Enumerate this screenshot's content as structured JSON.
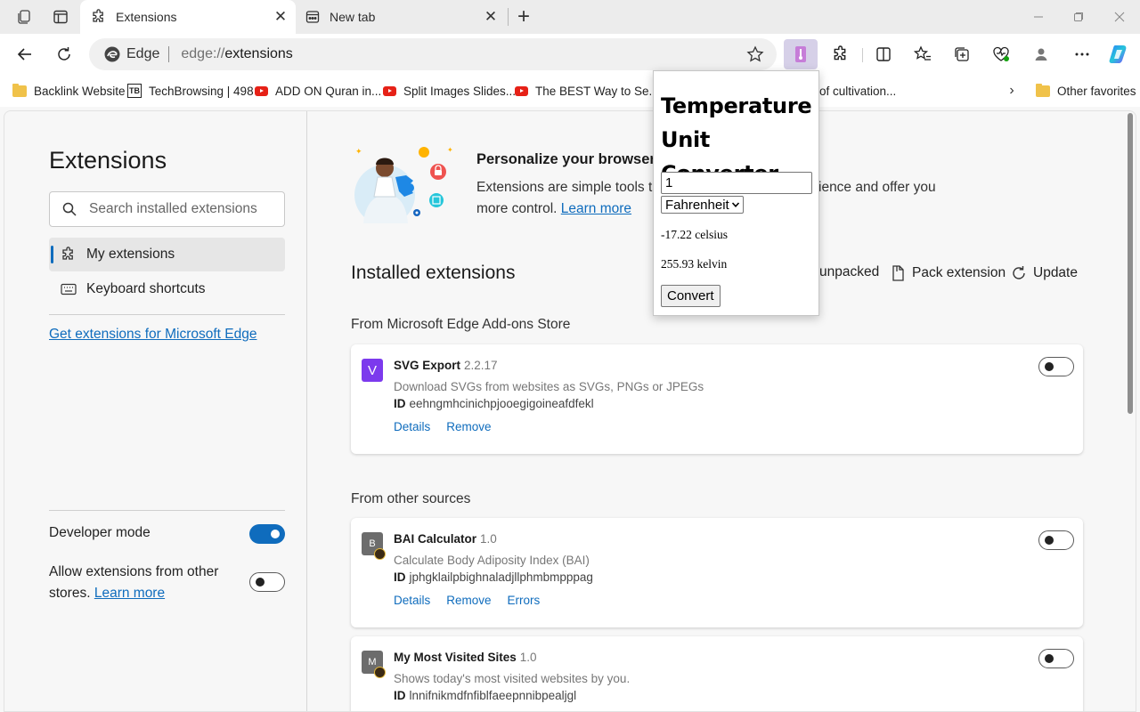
{
  "browser": {
    "tabs": [
      {
        "title": "Extensions",
        "active": true
      },
      {
        "title": "New tab",
        "active": false
      }
    ],
    "address": {
      "site_label": "Edge",
      "url_scheme": "edge://",
      "url_host": "extensions"
    },
    "favorites": [
      {
        "label": "Backlink Website",
        "icon": "folder-icon"
      },
      {
        "label": "TechBrowsing | 498",
        "icon": "techbrowsing-icon",
        "icon_text": "TB"
      },
      {
        "label": "ADD ON Quran in...",
        "icon": "youtube-icon"
      },
      {
        "label": "Split Images Slides...",
        "icon": "youtube-icon"
      },
      {
        "label": "The BEST Way to Se...",
        "icon": "youtube-icon"
      },
      {
        "label": "of cultivation...",
        "icon": "youtube-icon"
      }
    ],
    "other_favorites": "Other favorites"
  },
  "sidebar": {
    "title": "Extensions",
    "search_placeholder": "Search installed extensions",
    "nav": [
      {
        "label": "My extensions",
        "icon": "puzzle-icon",
        "selected": true
      },
      {
        "label": "Keyboard shortcuts",
        "icon": "keyboard-icon",
        "selected": false
      }
    ],
    "store_link": "Get extensions for Microsoft Edge",
    "developer_mode": {
      "label": "Developer mode",
      "on": true
    },
    "allow_other_stores": {
      "label": "Allow extensions from other stores.",
      "link": "Learn more",
      "on": false
    }
  },
  "main": {
    "hero": {
      "title": "Personalize your browser w",
      "desc_line1": "Extensions are simple tools that",
      "desc_line1_right": "ience and offer you",
      "desc_line2": "more control.",
      "learn_more": "Learn more"
    },
    "installed_title": "Installed extensions",
    "actions": [
      {
        "label": "unpacked",
        "icon": "load-unpacked-icon"
      },
      {
        "label": "Pack extension",
        "icon": "pack-icon"
      },
      {
        "label": "Update",
        "icon": "refresh-icon"
      }
    ],
    "sections": [
      {
        "label": "From Microsoft Edge Add-ons Store",
        "extensions": [
          {
            "name": "SVG Export",
            "version": "2.2.17",
            "icon_text": "V",
            "icon_color": "#7c3aed",
            "description": "Download SVGs from websites as SVGs, PNGs or JPEGs",
            "id_label": "ID",
            "id": "eehngmhcinichpjooegigoineafdfekl",
            "links": [
              "Details",
              "Remove"
            ],
            "enabled": false
          }
        ]
      },
      {
        "label": "From other sources",
        "extensions": [
          {
            "name": "BAI Calculator",
            "version": "1.0",
            "icon_text": "B",
            "icon_color": "#6c6c6c",
            "description": "Calculate Body Adiposity Index (BAI)",
            "id_label": "ID",
            "id": "jphgklailpbighnaladjllphmbmpppag",
            "links": [
              "Details",
              "Remove",
              "Errors"
            ],
            "enabled": false
          },
          {
            "name": "My Most Visited Sites",
            "version": "1.0",
            "icon_text": "M",
            "icon_color": "#6c6c6c",
            "description": "Shows today's most visited websites by you.",
            "id_label": "ID",
            "id": "lnnifnikmdfnfiblfaeepnnibpealjgl",
            "links": [],
            "enabled": false
          }
        ]
      }
    ]
  },
  "popup": {
    "title": "Temperature Unit Converter",
    "input_value": "1",
    "unit": "Fahrenheit",
    "result_celsius": "-17.22 celsius",
    "result_kelvin": "255.93 kelvin",
    "button": "Convert"
  },
  "colors": {
    "accent": "#0f6cbd",
    "extension_active_bg": "#d6d0e8"
  }
}
